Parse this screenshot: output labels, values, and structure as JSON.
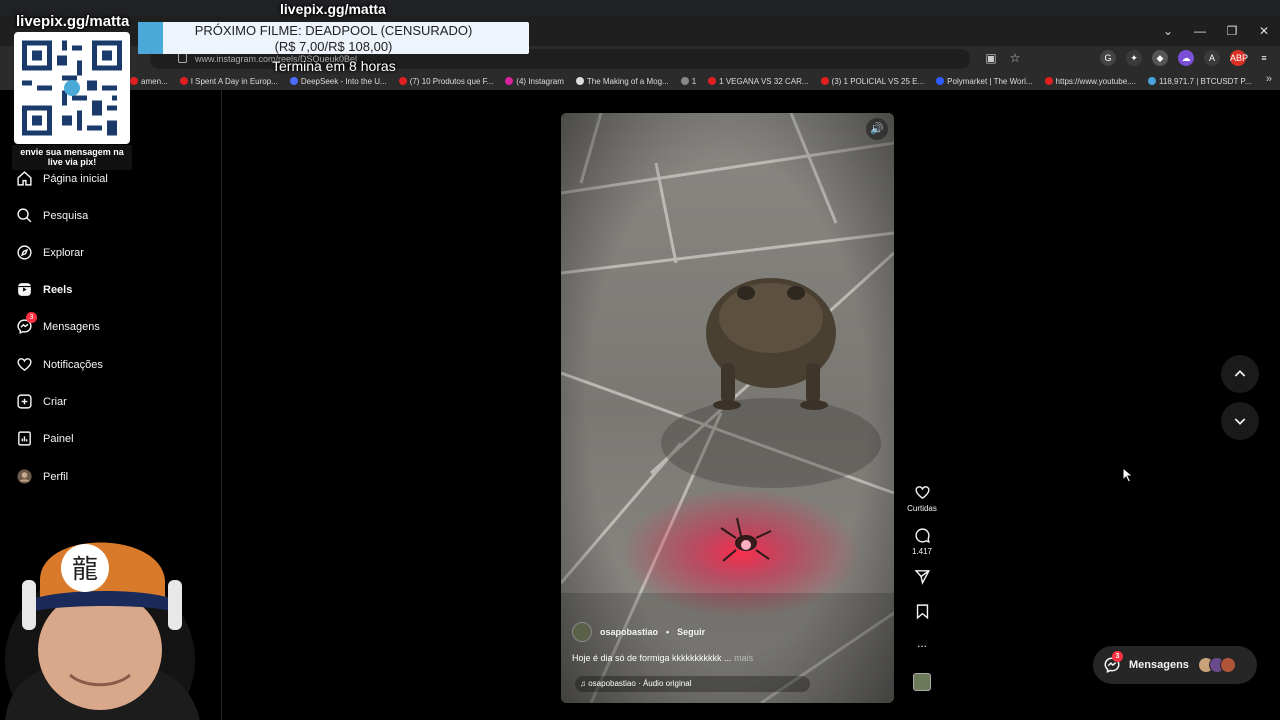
{
  "overlay": {
    "title": "livepix.gg/matta",
    "qr_url": "livepix.gg/matta",
    "qr_caption": "envie sua mensagem na live via pix!",
    "banner_line1": "PRÓXIMO FILME: DEADPOOL (CENSURADO)",
    "banner_line2": "(R$ 7,00/R$ 108,00)",
    "banner_countdown": "Termina em 8 horas",
    "banner_progress": 0.065
  },
  "browser": {
    "url": "www.instagram.com/reels/DSQueuk0Bel",
    "window_controls": [
      "⌄",
      "—",
      "❐",
      "✕"
    ],
    "bookmarks": [
      {
        "label": "amen...",
        "color": "#e02020"
      },
      {
        "label": "I Spent A Day in Europ...",
        "color": "#e02020"
      },
      {
        "label": "DeepSeek - Into the U...",
        "color": "#4d6bfe"
      },
      {
        "label": "(7) 10 Produtos que F...",
        "color": "#e02020"
      },
      {
        "label": "(4) Instagram",
        "color": "#d6249f"
      },
      {
        "label": "The Making of a Mog...",
        "color": "#dddddd"
      },
      {
        "label": "1",
        "color": "#888888"
      },
      {
        "label": "1 VEGANA VS 32 CAR...",
        "color": "#e02020"
      },
      {
        "label": "(3) 1 POLICIAL VS 25 E...",
        "color": "#e02020"
      },
      {
        "label": "Polymarket | The Worl...",
        "color": "#2e5bff"
      },
      {
        "label": "https://www.youtube....",
        "color": "#e02020"
      },
      {
        "label": "118,971.7 | BTCUSDT P...",
        "color": "#4aa3df"
      }
    ]
  },
  "sidebar": {
    "items": [
      {
        "label": "Página inicial",
        "icon": "home-icon"
      },
      {
        "label": "Pesquisa",
        "icon": "search-icon"
      },
      {
        "label": "Explorar",
        "icon": "compass-icon"
      },
      {
        "label": "Reels",
        "icon": "reels-icon"
      },
      {
        "label": "Mensagens",
        "icon": "messenger-icon",
        "badge": "3"
      },
      {
        "label": "Notificações",
        "icon": "heart-icon"
      },
      {
        "label": "Criar",
        "icon": "plus-square-icon"
      },
      {
        "label": "Painel",
        "icon": "dashboard-icon"
      },
      {
        "label": "Perfil",
        "icon": "avatar"
      }
    ]
  },
  "reel": {
    "author": "osapobastiao",
    "separator": "•",
    "follow": "Seguir",
    "caption": "Hoje é dia só de formiga kkkkkkkkkkk ...",
    "more": "mais",
    "audio": "osapobastiao · Áudio original"
  },
  "actions": {
    "likes": "Curtidas",
    "comments": "1.417",
    "more": "..."
  },
  "messages_pill": {
    "label": "Mensagens",
    "badge": "3"
  },
  "colors": {
    "accent_red": "#ff3040",
    "banner_blue": "#4aa9d8",
    "background": "#000000"
  }
}
